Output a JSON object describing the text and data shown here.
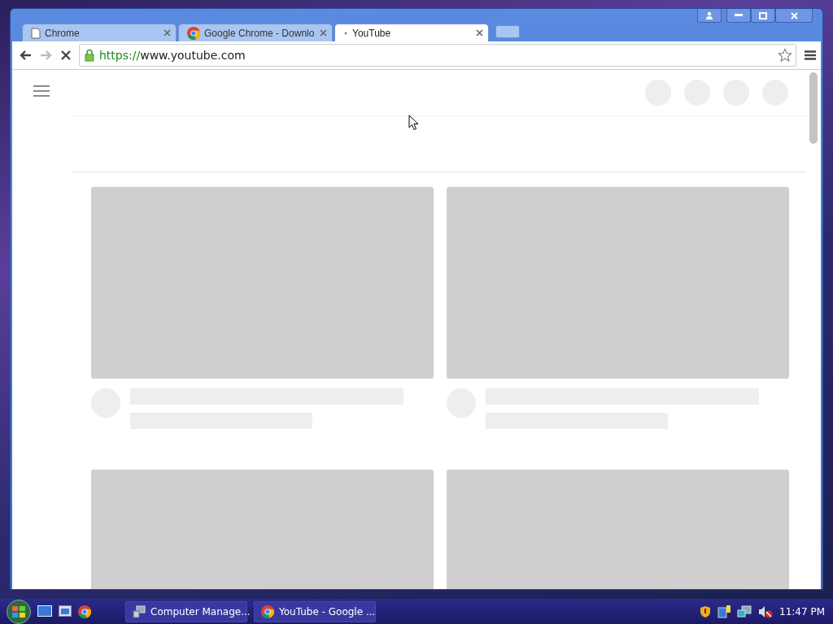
{
  "browser": {
    "tabs": [
      {
        "title": "Chrome",
        "kind": "page",
        "selected": false
      },
      {
        "title": "Google Chrome - Downlo",
        "kind": "chrome",
        "selected": false
      },
      {
        "title": "YouTube",
        "kind": "loading",
        "selected": true
      }
    ],
    "address": {
      "url": "https://www.youtube.com",
      "secure": true
    },
    "loading": true,
    "page": {
      "cards": [
        {
          "kind": "video"
        },
        {
          "kind": "video"
        },
        {
          "kind": "cut"
        },
        {
          "kind": "cut"
        }
      ]
    }
  },
  "taskbar": {
    "buttons": [
      {
        "label": "Computer Manage..."
      },
      {
        "label": "YouTube - Google ..."
      }
    ],
    "clock": "11:47 PM"
  }
}
